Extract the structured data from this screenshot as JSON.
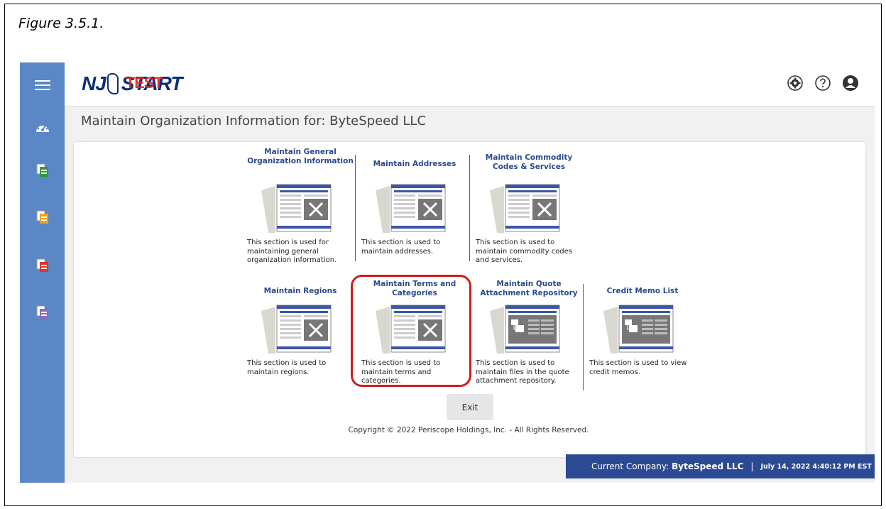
{
  "caption": "Figure 3.5.1.",
  "header": {
    "logo_main": "NJ",
    "logo_start": "START",
    "logo_overlay": "TEST"
  },
  "sidebar": {
    "items": [
      {
        "icon": "hamburger-menu-icon"
      },
      {
        "icon": "dashboard-gauge-icon"
      },
      {
        "icon": "green-document-icon"
      },
      {
        "icon": "orange-document-icon"
      },
      {
        "icon": "red-document-icon"
      },
      {
        "icon": "purple-document-icon"
      }
    ]
  },
  "top_icons": [
    "settings-gear-icon",
    "help-question-icon",
    "user-profile-icon"
  ],
  "page": {
    "title": "Maintain Organization Information for: ByteSpeed LLC"
  },
  "tiles": [
    {
      "title": "Maintain General Organization Information",
      "desc": "This section is used for maintaining general organization information.",
      "icon": "document-tools-icon"
    },
    {
      "title": "Maintain Addresses",
      "desc": "This section is used to maintain addresses.",
      "icon": "document-tools-icon"
    },
    {
      "title": "Maintain Commodity Codes & Services",
      "desc": "This section is used to maintain commodity codes and services.",
      "icon": "document-tools-icon"
    },
    {
      "title": "Maintain Regions",
      "desc": "This section is used to maintain regions.",
      "icon": "document-tools-icon"
    },
    {
      "title": "Maintain Terms and Categories",
      "desc": "This section is used to maintain terms and categories.",
      "icon": "document-tools-icon"
    },
    {
      "title": "Maintain Quote Attachment Repository",
      "desc": "This section is used to maintain files in the quote attachment repository.",
      "icon": "document-list-icon"
    },
    {
      "title": "Credit Memo List",
      "desc": "This section is used to view credit memos.",
      "icon": "document-list-icon"
    }
  ],
  "buttons": {
    "exit": "Exit"
  },
  "footer": {
    "copyright": "Copyright © 2022 Periscope Holdings, Inc. - All Rights Reserved."
  },
  "status": {
    "label": "Current Company:",
    "company": "ByteSpeed LLC",
    "separator": "|",
    "datetime": "July 14, 2022 4:40:12 PM EST"
  },
  "colors": {
    "sidebar": "#5a87c6",
    "link": "#2a4a8e",
    "highlight": "#d01c1c",
    "statusbar": "#2c4a94"
  }
}
